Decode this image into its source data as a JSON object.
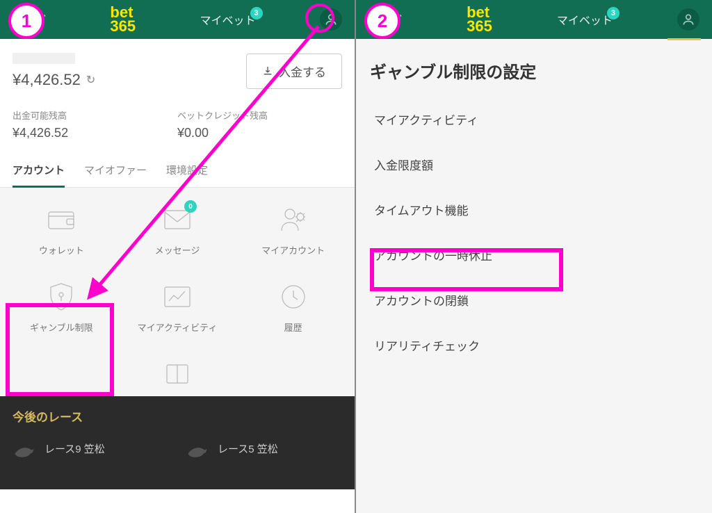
{
  "annotations": {
    "step1": "1",
    "step2": "2"
  },
  "header": {
    "nav_live": "ライブ",
    "logo_top": "bet",
    "logo_bot": "365",
    "nav_mybet": "マイベット",
    "notif_count": "3"
  },
  "balance": {
    "main": "¥4,426.52",
    "deposit_btn": "入金する",
    "withdrawable_label": "出金可能残高",
    "withdrawable_value": "¥4,426.52",
    "betcredit_label": "ベットクレジット残高",
    "betcredit_value": "¥0.00"
  },
  "tabs": {
    "account": "アカウント",
    "myoffer": "マイオファー",
    "prefs": "環境設定"
  },
  "grid": {
    "wallet": "ウォレット",
    "messages": "メッセージ",
    "msg_count": "0",
    "myaccount": "マイアカウント",
    "gambling": "ギャンブル制限",
    "myactivity": "マイアクティビティ",
    "history": "履歴"
  },
  "footer": {
    "upcoming": "今後のレース",
    "race1": "レース9 笠松",
    "race2": "レース5 笠松"
  },
  "settings": {
    "title": "ギャンブル制限の設定",
    "items": [
      "マイアクティビティ",
      "入金限度額",
      "タイムアウト機能",
      "アカウントの一時休止",
      "アカウントの閉鎖",
      "リアリティチェック"
    ]
  }
}
